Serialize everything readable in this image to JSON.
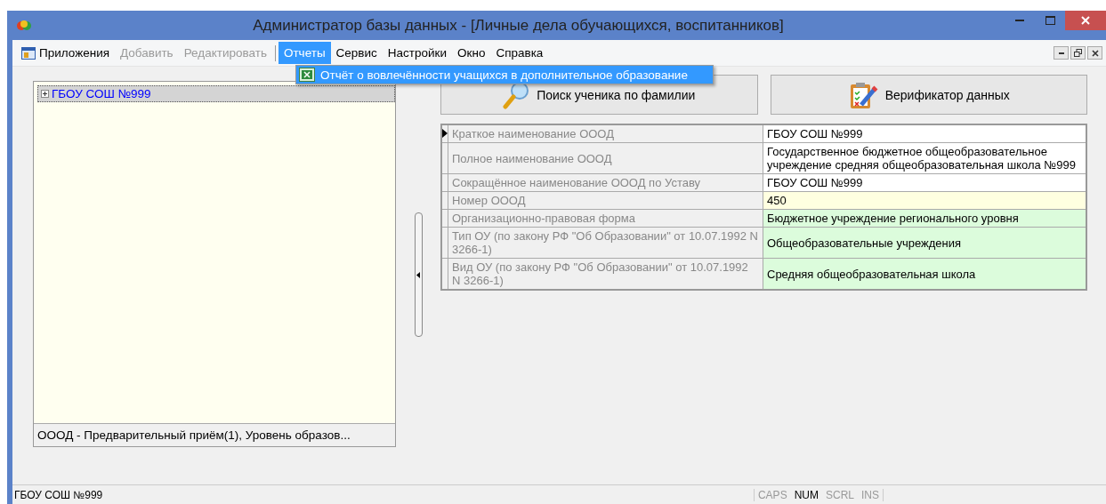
{
  "window": {
    "title": "Администратор базы данных - [Личные дела обучающихся, воспитанников]"
  },
  "menu": [
    {
      "label": "Приложения",
      "disabled": false,
      "selected": false,
      "icon": true
    },
    {
      "label": "Добавить",
      "disabled": true,
      "selected": false
    },
    {
      "label": "Редактировать",
      "disabled": true,
      "selected": false
    },
    {
      "label": "Отчеты",
      "disabled": false,
      "selected": true
    },
    {
      "label": "Сервис",
      "disabled": false,
      "selected": false
    },
    {
      "label": "Настройки",
      "disabled": false,
      "selected": false
    },
    {
      "label": "Окно",
      "disabled": false,
      "selected": false
    },
    {
      "label": "Справка",
      "disabled": false,
      "selected": false
    }
  ],
  "dropdown": {
    "items": [
      {
        "label": "Отчёт о вовлечённости учащихся в дополнительное образование",
        "selected": true
      }
    ]
  },
  "tree": {
    "items": [
      {
        "label": "ГБОУ СОШ №999",
        "selected": true,
        "expanded": false
      }
    ],
    "footer": "ОООД - Предварительный приём(1), Уровень образов..."
  },
  "buttons": [
    {
      "label": "Поиск ученика по фамилии",
      "kind": "search"
    },
    {
      "label": "Верификатор данных",
      "kind": "verify"
    }
  ],
  "properties": [
    {
      "name": "Краткое наименование ОООД",
      "value": "ГБОУ СОШ №999",
      "color": "#ffffff",
      "current": true
    },
    {
      "name": "Полное наименование ОООД",
      "value": "Государственное бюджетное общеобразовательное учреждение средняя общеобразовательная школа №999",
      "color": "#ffffff",
      "current": false
    },
    {
      "name": "Сокращённое наименование ОООД по Уставу",
      "value": "ГБОУ СОШ №999",
      "color": "#ffffff",
      "current": false
    },
    {
      "name": "Номер ОООД",
      "value": "450",
      "color": "#ffffe0",
      "current": false
    },
    {
      "name": "Организационно-правовая форма",
      "value": "Бюджетное учреждение регионального уровня",
      "color": "#dcfcdc",
      "current": false
    },
    {
      "name": "Тип ОУ (по закону  РФ \"Об Образовании\" от 10.07.1992 N 3266-1)",
      "value": "Общеобразовательные учреждения",
      "color": "#dcfcdc",
      "current": false
    },
    {
      "name": "Вид ОУ (по закону  РФ \"Об Образовании\" от 10.07.1992 N 3266-1)",
      "value": "Средняя общеобразовательная школа",
      "color": "#dcfcdc",
      "current": false
    }
  ],
  "status_bar": {
    "text": "ГБОУ СОШ №999",
    "indicators": [
      {
        "label": "CAPS",
        "on": false
      },
      {
        "label": "NUM",
        "on": true
      },
      {
        "label": "SCRL",
        "on": false
      },
      {
        "label": "INS",
        "on": false
      }
    ]
  }
}
